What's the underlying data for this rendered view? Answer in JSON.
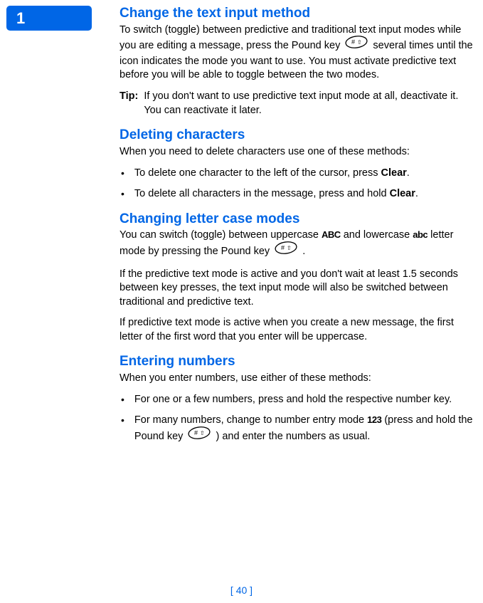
{
  "pageTab": "1",
  "sections": {
    "changeInput": {
      "heading": "Change the text input method",
      "p1a": "To switch (toggle) between predictive and traditional text input modes while you are editing a message, press the Pound key ",
      "p1b": " several times until the icon indicates the mode you want to use. You must activate predictive text before you will be able to toggle between the two modes.",
      "tipLabel": "Tip:",
      "tipText": "If you don't want to use predictive text input mode at all, deactivate it. You can reactivate it later."
    },
    "deleting": {
      "heading": "Deleting characters",
      "intro": "When you need to delete characters use one of these methods:",
      "b1a": "To delete one character to the left of the cursor, press ",
      "b1clear": "Clear",
      "b1b": ".",
      "b2a": "To delete all characters in the message, press and hold ",
      "b2clear": "Clear",
      "b2b": "."
    },
    "lettercase": {
      "heading": "Changing letter case modes",
      "p1a": "You can switch (toggle) between uppercase ",
      "abcUpper": "ABC",
      "p1b": " and lowercase ",
      "abcLower": "abc",
      "p1c": " letter mode by pressing the Pound key ",
      "p1d": " .",
      "p2": "If the predictive text mode is active and you don't wait at least 1.5 seconds between key presses, the text input mode will also be switched between traditional and predictive text.",
      "p3": "If predictive text mode is active when you create a new message, the first letter of the first word that you enter will be uppercase."
    },
    "numbers": {
      "heading": "Entering numbers",
      "intro": "When you enter numbers, use either of these methods:",
      "b1": "For one or a few numbers, press and hold the respective number key.",
      "b2a": "For many numbers, change to number entry mode ",
      "numIcon": "123",
      "b2b": " (press and hold the Pound key ",
      "b2c": " ) and enter the numbers as usual."
    }
  },
  "pageNumber": "[ 40 ]"
}
